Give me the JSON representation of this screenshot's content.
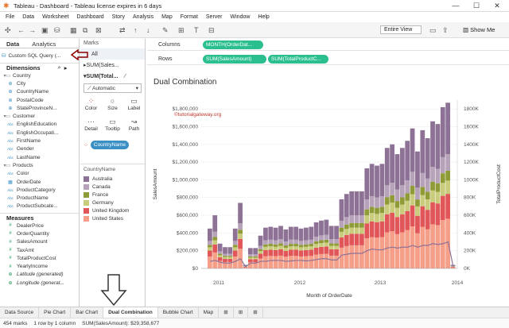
{
  "window": {
    "title": "Tableau - Dashboard - Tableau license expires in 6 days"
  },
  "menu": [
    "File",
    "Data",
    "Worksheet",
    "Dashboard",
    "Story",
    "Analysis",
    "Map",
    "Format",
    "Server",
    "Window",
    "Help"
  ],
  "toolbar": {
    "fit": "Entire View",
    "show_me": "Show Me"
  },
  "left": {
    "tabs": [
      "Data",
      "Analytics"
    ],
    "datasource": "Custom SQL Query (...",
    "dimensions_label": "Dimensions",
    "dimensions": [
      {
        "label": "Country",
        "type": "folder"
      },
      {
        "label": "City",
        "type": "geo"
      },
      {
        "label": "CountryName",
        "type": "geo"
      },
      {
        "label": "PostalCode",
        "type": "geo"
      },
      {
        "label": "StateProvinceN...",
        "type": "geo"
      },
      {
        "label": "Customer",
        "type": "folder"
      },
      {
        "label": "EnglishEducation",
        "type": "abc"
      },
      {
        "label": "EnglishOccupati...",
        "type": "abc"
      },
      {
        "label": "FirstName",
        "type": "abc"
      },
      {
        "label": "Gender",
        "type": "abc"
      },
      {
        "label": "LastName",
        "type": "abc"
      },
      {
        "label": "Products",
        "type": "folder"
      },
      {
        "label": "Color",
        "type": "abc"
      },
      {
        "label": "OrderDate",
        "type": "date"
      },
      {
        "label": "ProductCategory",
        "type": "abc"
      },
      {
        "label": "ProductName",
        "type": "abc"
      },
      {
        "label": "ProductSubcate...",
        "type": "abc"
      }
    ],
    "measures_label": "Measures",
    "measures": [
      "DealerPrice",
      "OrderQuantity",
      "SalesAmount",
      "TaxAmt",
      "TotalProductCost",
      "YearlyIncome",
      "Latitude (generated)",
      "Longitude (generat..."
    ]
  },
  "marks": {
    "title": "Marks",
    "all": "All",
    "items": [
      "SUM(Sales...",
      "SUM(Total..."
    ],
    "type": "Automatic",
    "buttons": [
      "Color",
      "Size",
      "Label",
      "Detail",
      "Tooltip",
      "Path"
    ],
    "color_pill": "CountryName",
    "legend_title": "CountryName",
    "legend": [
      {
        "name": "Australia",
        "color": "#8e7296"
      },
      {
        "name": "Canada",
        "color": "#b7a3b9"
      },
      {
        "name": "France",
        "color": "#8f9b36"
      },
      {
        "name": "Germany",
        "color": "#c8cc7c"
      },
      {
        "name": "United Kingdom",
        "color": "#e15759"
      },
      {
        "name": "United States",
        "color": "#f59e88"
      }
    ]
  },
  "shelves": {
    "columns_label": "Columns",
    "columns": [
      "MONTH(OrderDat..."
    ],
    "rows_label": "Rows",
    "rows": [
      "SUM(SalesAmount)",
      "SUM(TotalProductC..."
    ]
  },
  "chart_data": {
    "type": "bar",
    "title": "Dual Combination",
    "watermark": "©tutorialgateway.org",
    "xlabel": "Month of OrderDate",
    "ylabel": "SalesAmount",
    "y2label": "TotalProductCost",
    "x_ticks": [
      "2011",
      "2012",
      "2013",
      "2014"
    ],
    "y_ticks": [
      "$0",
      "$200,000",
      "$400,000",
      "$600,000",
      "$800,000",
      "$1,000,000",
      "$1,200,000",
      "$1,400,000",
      "$1,600,000",
      "$1,800,000"
    ],
    "y2_ticks": [
      "0K",
      "200K",
      "400K",
      "600K",
      "800K",
      "1000K",
      "1200K",
      "1400K",
      "1600K",
      "1800K"
    ],
    "ylim": [
      0,
      1900000
    ],
    "stacks": [
      [
        120000,
        160000,
        70000,
        60000,
        60000,
        120000,
        200000,
        10000,
        60000,
        60000,
        100000
      ],
      [
        30000,
        40000,
        20000,
        15000,
        15000,
        30000,
        50000,
        3000,
        15000,
        15000,
        25000
      ],
      [
        40000,
        50000,
        25000,
        20000,
        20000,
        40000,
        70000,
        4000,
        20000,
        20000,
        30000
      ],
      [
        30000,
        40000,
        20000,
        15000,
        15000,
        30000,
        50000,
        3000,
        15000,
        15000,
        25000
      ],
      [
        70000,
        90000,
        40000,
        35000,
        35000,
        70000,
        110000,
        6000,
        35000,
        35000,
        60000
      ],
      [
        160000,
        220000,
        90000,
        80000,
        80000,
        160000,
        260000,
        14000,
        80000,
        80000,
        130000
      ]
    ],
    "series_colors": [
      "#f59e88",
      "#e15759",
      "#c8cc7c",
      "#8f9b36",
      "#b7a3b9",
      "#8e7296"
    ],
    "bar_totals": [
      450000,
      600000,
      280000,
      240000,
      240000,
      450000,
      740000,
      40000,
      230000,
      230000,
      370000,
      460000,
      470000,
      460000,
      480000,
      440000,
      470000,
      470000,
      450000,
      460000,
      470000,
      520000,
      540000,
      550000,
      480000,
      480000,
      780000,
      840000,
      870000,
      870000,
      870000,
      1130000,
      1180000,
      1160000,
      1180000,
      1360000,
      1400000,
      1290000,
      1360000,
      1440000,
      1580000,
      1320000,
      1560000,
      1470000,
      1660000,
      1630000,
      1820000,
      1870000,
      40000
    ],
    "line_values": [
      80000,
      90000,
      70000,
      60000,
      60000,
      80000,
      110000,
      20000,
      60000,
      60000,
      80000,
      80000,
      90000,
      90000,
      90000,
      80000,
      85000,
      90000,
      90000,
      85000,
      90000,
      100000,
      110000,
      110000,
      95000,
      95000,
      150000,
      160000,
      170000,
      170000,
      170000,
      200000,
      220000,
      210000,
      210000,
      230000,
      240000,
      230000,
      240000,
      240000,
      260000,
      240000,
      260000,
      260000,
      280000,
      270000,
      280000,
      300000,
      20000
    ]
  },
  "tabs_bottom": [
    "Data Source",
    "Pie Chart",
    "Bar Chart",
    "Dual Combination",
    "Bubble Chart",
    "Map"
  ],
  "status": {
    "marks": "454 marks",
    "rows": "1 row by 1 column",
    "sum": "SUM(SalesAmount): $29,358,677"
  }
}
